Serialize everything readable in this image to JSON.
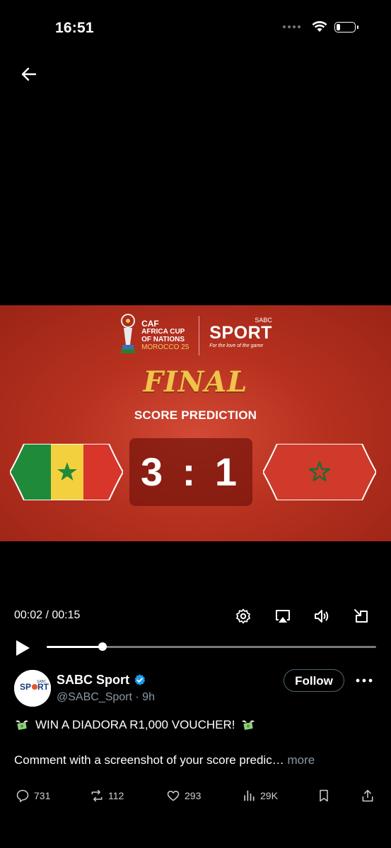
{
  "status_bar": {
    "time": "16:51"
  },
  "video": {
    "banner": {
      "afcon_logo": {
        "caf": "CAF",
        "line1": "AFRICA CUP",
        "line2": "OF NATIONS",
        "line3": "MOROCCO 25"
      },
      "sabc_logo": {
        "sabc": "SABC",
        "sport": "SPORT",
        "tagline": "For the love of the game"
      },
      "final_text": "FINAL",
      "subtitle": "SCORE PREDICTION",
      "score": "3 : 1",
      "team_left_flag": "Senegal flag",
      "team_right_flag": "Morocco flag"
    },
    "time_readout": "00:02 / 00:15",
    "progress": 0.17,
    "icons": [
      "back-arrow-icon",
      "settings-icon",
      "airplay-icon",
      "volume-icon",
      "exit-fullscreen-icon",
      "play-icon"
    ]
  },
  "post": {
    "author": "SABC Sport",
    "handle": "@SABC_Sport · 9h",
    "follow_label": "Follow",
    "line1_text": "WIN A DIADORA R1,000 VOUCHER!",
    "line2_text": "Comment with a screenshot of your score predic…",
    "more_label": "more",
    "actions": {
      "replies": "731",
      "reposts": "112",
      "likes": "293",
      "views": "29K"
    }
  },
  "colors": {
    "banner_red": "#b7311f",
    "gold": "#f2c24a",
    "verified_blue": "#1d9bf0",
    "muted": "#8b98a5"
  }
}
